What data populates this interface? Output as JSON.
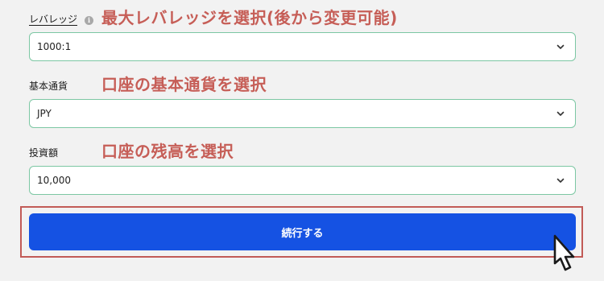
{
  "fields": [
    {
      "label": "レバレッジ",
      "has_info_icon": true,
      "info_icon": "info-icon",
      "annotation": "最大レバレッジを選択(後から変更可能)",
      "value": "1000:1"
    },
    {
      "label": "基本通貨",
      "annotation": "口座の基本通貨を選択",
      "value": "JPY"
    },
    {
      "label": "投資額",
      "annotation": "口座の残高を選択",
      "value": "10,000"
    }
  ],
  "continue_button": {
    "label": "続行する"
  },
  "colors": {
    "annotation": "#c65e57",
    "select_border": "#7cc7a3",
    "button": "#1552e3",
    "highlight_frame": "#c25b57",
    "background": "#f2f2f2"
  },
  "icons": [
    "info-icon",
    "chevron-down-icon",
    "mouse-pointer-icon"
  ]
}
